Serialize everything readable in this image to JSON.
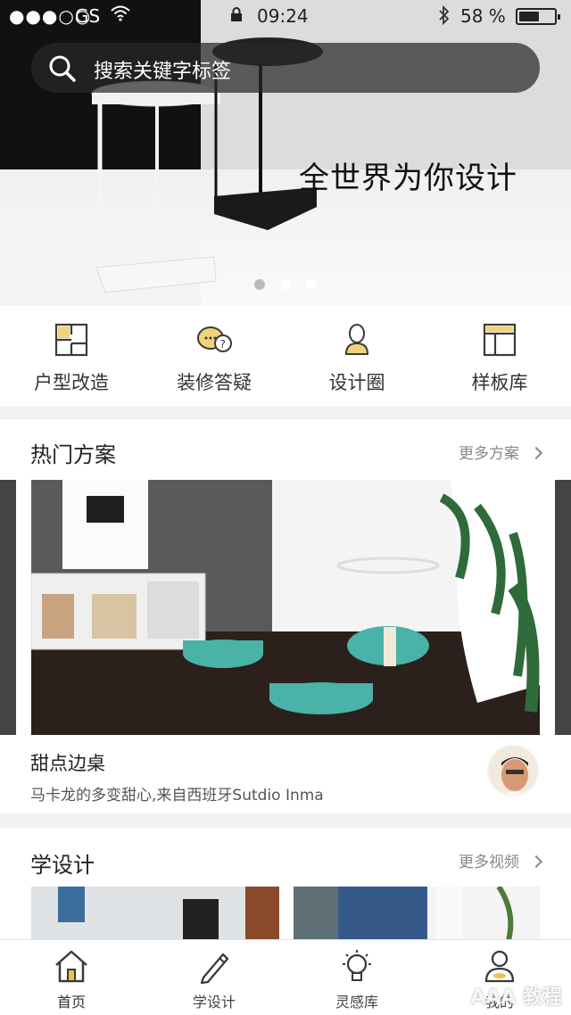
{
  "status_bar": {
    "signal": "●●●○○",
    "carrier": "GS",
    "time": "09:24",
    "battery": "58 %",
    "battery_level": 0.58
  },
  "search": {
    "placeholder": "搜索关键字标签"
  },
  "banner": {
    "slogan": "全世界为你设计",
    "dots_count": 3,
    "active_dot": 0
  },
  "quick_nav": [
    {
      "label": "户型改造",
      "icon": "floorplan-icon"
    },
    {
      "label": "装修答疑",
      "icon": "chat-bubbles-icon"
    },
    {
      "label": "设计圈",
      "icon": "person-icon"
    },
    {
      "label": "样板库",
      "icon": "layout-icon"
    }
  ],
  "hot": {
    "title": "热门方案",
    "more": "更多方案",
    "card": {
      "title": "甜点边桌",
      "subtitle": "马卡龙的多变甜心,来自西班牙Sutdio Inma"
    }
  },
  "learn": {
    "title": "学设计",
    "more": "更多视频"
  },
  "tabbar": [
    {
      "label": "首页",
      "icon": "home-icon",
      "active": true
    },
    {
      "label": "学设计",
      "icon": "pencil-icon",
      "active": false
    },
    {
      "label": "灵感库",
      "icon": "lightbulb-icon",
      "active": false
    },
    {
      "label": "我的",
      "icon": "profile-icon",
      "active": false
    }
  ],
  "colors": {
    "accent": "#d9a93a",
    "icon_stroke": "#3a3a3a"
  },
  "watermark": "AAA 教程"
}
